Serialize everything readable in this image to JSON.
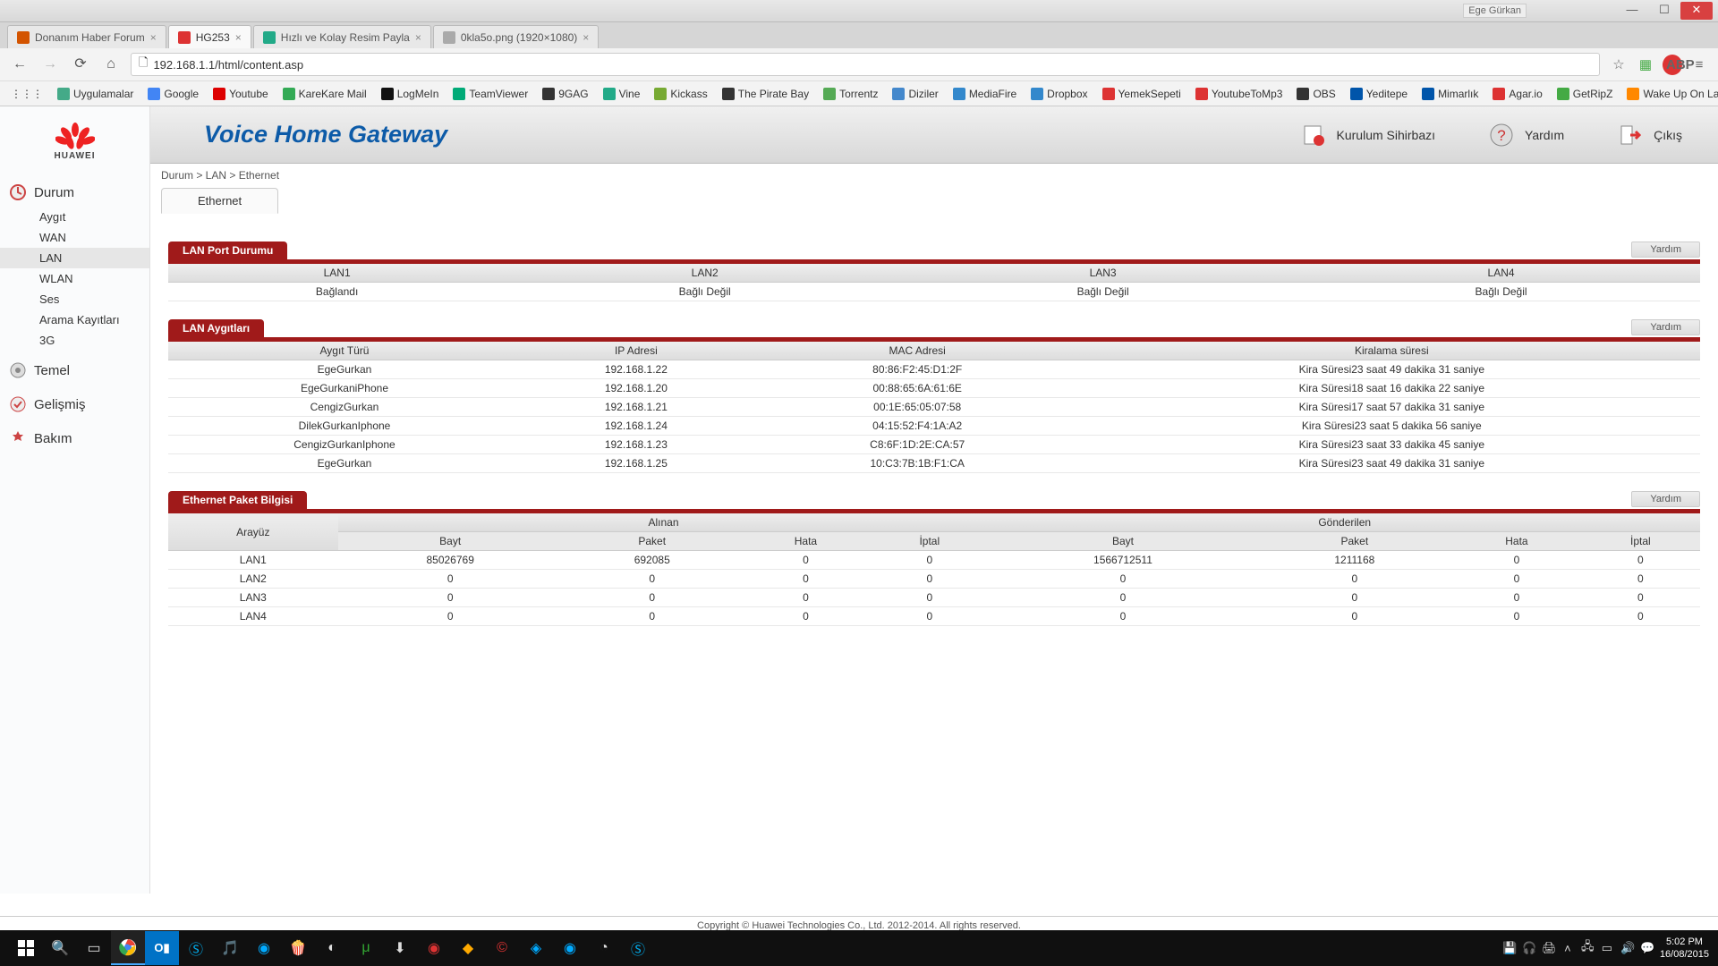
{
  "titlebar": {
    "user": "Ege Gürkan"
  },
  "tabs": [
    {
      "label": "Donanım Haber Forum",
      "fav": "#d35400"
    },
    {
      "label": "HG253",
      "fav": "#d33",
      "active": true
    },
    {
      "label": "Hızlı ve Kolay Resim Payla",
      "fav": "#2a8"
    },
    {
      "label": "0kla5o.png (1920×1080)",
      "fav": "#aaa"
    }
  ],
  "url": "192.168.1.1/html/content.asp",
  "bookmarks": [
    "Uygulamalar",
    "Google",
    "Youtube",
    "KareKare Mail",
    "LogMeIn",
    "TeamViewer",
    "9GAG",
    "Vine",
    "Kickass",
    "The Pirate Bay",
    "Torrentz",
    "Diziler",
    "MediaFire",
    "Dropbox",
    "YemekSepeti",
    "YoutubeToMp3",
    "OBS",
    "Yeditepe",
    "Mimarlık",
    "Agar.io",
    "GetRipZ",
    "Wake Up On Lan - T..."
  ],
  "bookmark_colors": [
    "#4a8",
    "#4285f4",
    "#d00",
    "#3a5",
    "#111",
    "#0a7",
    "#333",
    "#2a8",
    "#7a3",
    "#333",
    "#5a5",
    "#48c",
    "#38c",
    "#38c",
    "#d33",
    "#d33",
    "#333",
    "#05a",
    "#05a",
    "#d33",
    "#4a4",
    "#f80"
  ],
  "router": {
    "title": "Voice Home Gateway",
    "actions": {
      "wizard": "Kurulum Sihirbazı",
      "help": "Yardım",
      "logout": "Çıkış"
    },
    "crumbs": "Durum > LAN > Ethernet",
    "inner_tab": "Ethernet"
  },
  "sidebar": {
    "groups": [
      {
        "head": "Durum",
        "items": [
          "Aygıt",
          "WAN",
          "LAN",
          "WLAN",
          "Ses",
          "Arama Kayıtları",
          "3G"
        ],
        "active_item": "LAN",
        "expanded": true
      },
      {
        "head": "Temel"
      },
      {
        "head": "Gelişmiş"
      },
      {
        "head": "Bakım"
      }
    ]
  },
  "lan_port": {
    "title": "LAN Port Durumu",
    "help": "Yardım",
    "headers": [
      "LAN1",
      "LAN2",
      "LAN3",
      "LAN4"
    ],
    "row": [
      "Bağlandı",
      "Bağlı Değil",
      "Bağlı Değil",
      "Bağlı Değil"
    ]
  },
  "lan_devices": {
    "title": "LAN Aygıtları",
    "help": "Yardım",
    "headers": [
      "Aygıt Türü",
      "IP Adresi",
      "MAC Adresi",
      "Kiralama süresi"
    ],
    "rows": [
      [
        "EgeGurkan",
        "192.168.1.22",
        "80:86:F2:45:D1:2F",
        "Kira Süresi23 saat 49 dakika 31 saniye"
      ],
      [
        "EgeGurkaniPhone",
        "192.168.1.20",
        "00:88:65:6A:61:6E",
        "Kira Süresi18 saat 16 dakika 22 saniye"
      ],
      [
        "CengizGurkan",
        "192.168.1.21",
        "00:1E:65:05:07:58",
        "Kira Süresi17 saat 57 dakika 31 saniye"
      ],
      [
        "DilekGurkanIphone",
        "192.168.1.24",
        "04:15:52:F4:1A:A2",
        "Kira Süresi23 saat 5 dakika 56 saniye"
      ],
      [
        "CengizGurkanIphone",
        "192.168.1.23",
        "C8:6F:1D:2E:CA:57",
        "Kira Süresi23 saat 33 dakika 45 saniye"
      ],
      [
        "EgeGurkan",
        "192.168.1.25",
        "10:C3:7B:1B:F1:CA",
        "Kira Süresi23 saat 49 dakika 31 saniye"
      ]
    ]
  },
  "pkt": {
    "title": "Ethernet Paket Bilgisi",
    "help": "Yardım",
    "top_headers": [
      "Arayüz",
      "Alınan",
      "Gönderilen"
    ],
    "sub_headers": [
      "Bayt",
      "Paket",
      "Hata",
      "İptal",
      "Bayt",
      "Paket",
      "Hata",
      "İptal"
    ],
    "rows": [
      [
        "LAN1",
        "85026769",
        "692085",
        "0",
        "0",
        "1566712511",
        "1211168",
        "0",
        "0"
      ],
      [
        "LAN2",
        "0",
        "0",
        "0",
        "0",
        "0",
        "0",
        "0",
        "0"
      ],
      [
        "LAN3",
        "0",
        "0",
        "0",
        "0",
        "0",
        "0",
        "0",
        "0"
      ],
      [
        "LAN4",
        "0",
        "0",
        "0",
        "0",
        "0",
        "0",
        "0",
        "0"
      ]
    ]
  },
  "footer": "Copyright © Huawei Technologies Co., Ltd. 2012-2014. All rights reserved.",
  "clock": {
    "time": "5:02 PM",
    "date": "16/08/2015"
  }
}
